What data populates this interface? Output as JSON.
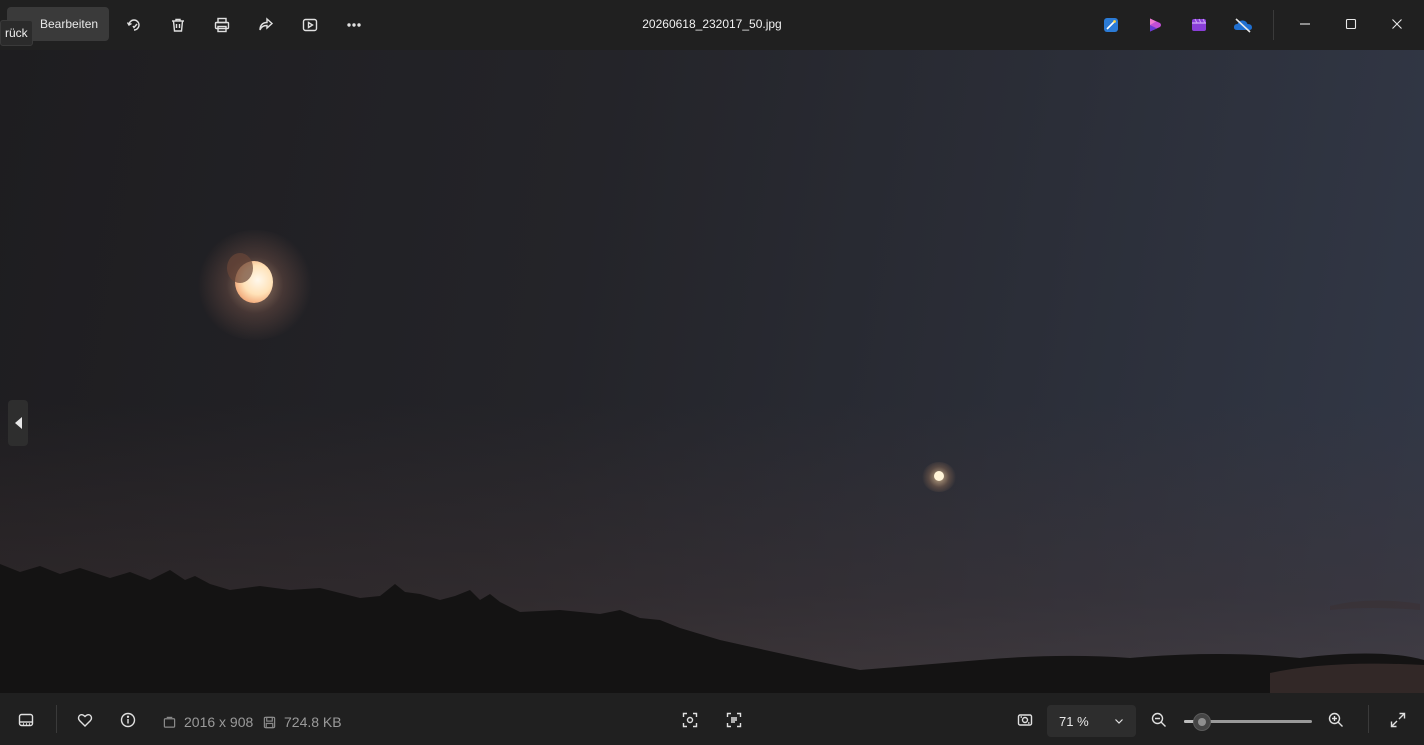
{
  "toolbar": {
    "back_tooltip": "rück",
    "edit_label": "Bearbeiten",
    "file_title": "20260618_232017_50.jpg",
    "icons": [
      "rotate-icon",
      "delete-icon",
      "print-icon",
      "share-icon",
      "slideshow-icon",
      "more-icon"
    ],
    "apps": [
      "designer-icon",
      "clipchamp-icon",
      "video-editor-icon",
      "onedrive-icon"
    ]
  },
  "info": {
    "dimensions": "2016 x 908",
    "filesize": "724.8 KB"
  },
  "zoom": {
    "value": "71 %",
    "level_fraction": 0.14
  }
}
